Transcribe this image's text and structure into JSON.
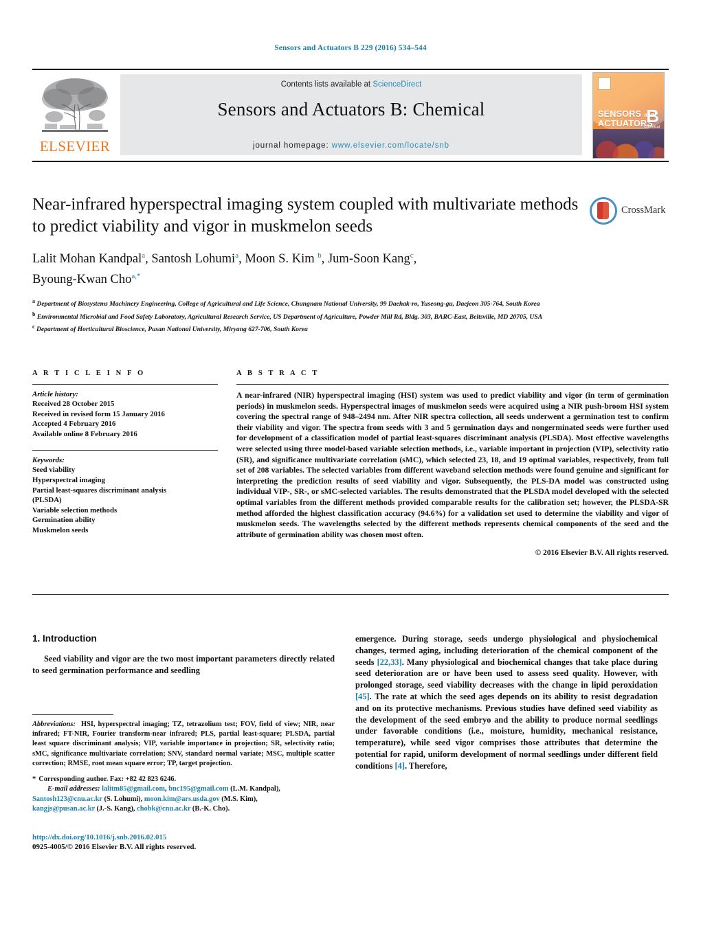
{
  "running_head": "Sensors and Actuators B 229 (2016) 534–544",
  "masthead": {
    "contents_prefix": "Contents lists available at ",
    "sciencedirect": "ScienceDirect",
    "journal_title": "Sensors and Actuators B: Chemical",
    "homepage_label": "journal homepage:",
    "homepage_url": "www.elsevier.com/locate/snb",
    "publisher": "ELSEVIER",
    "cover": {
      "line1": "SENSORS",
      "and": "and",
      "line2": "ACTUATORS",
      "letter": "B",
      "sub": "Chemical"
    },
    "accent_blue": "#2b8cbe",
    "elsevier_orange": "#E87722"
  },
  "article": {
    "title": "Near-infrared hyperspectral imaging system coupled with multivariate methods to predict viability and vigor in muskmelon seeds",
    "authors_line1": "Lalit Mohan Kandpal",
    "authors": [
      {
        "name": "Lalit Mohan Kandpal",
        "sup": "a"
      },
      {
        "name": "Santosh Lohumi",
        "sup": "a"
      },
      {
        "name": "Moon S. Kim",
        "sup": "b"
      },
      {
        "name": "Jum-Soon Kang",
        "sup": "c"
      },
      {
        "name": "Byoung-Kwan Cho",
        "sup": "a,*"
      }
    ],
    "affiliations": [
      {
        "sup": "a",
        "text": "Department of Biosystems Machinery Engineering, College of Agricultural and Life Science, Chungnam National University, 99 Daehak-ro, Yuseong-gu, Daejeon 305-764, South Korea"
      },
      {
        "sup": "b",
        "text": "Environmental Microbial and Food Safety Laboratory, Agricultural Research Service, US Department of Agriculture, Powder Mill Rd, Bldg. 303, BARC-East, Beltsville, MD 20705, USA"
      },
      {
        "sup": "c",
        "text": "Department of Horticultural Bioscience, Pusan National University, Miryang 627-706, South Korea"
      }
    ],
    "crossmark_label": "CrossMark"
  },
  "article_info": {
    "heading": "A R T I C L E   I N F O",
    "history_label": "Article history:",
    "history": [
      "Received 28 October 2015",
      "Received in revised form 15 January 2016",
      "Accepted 4 February 2016",
      "Available online 8 February 2016"
    ],
    "keywords_label": "Keywords:",
    "keywords": [
      "Seed viability",
      "Hyperspectral imaging",
      "Partial least-squares discriminant analysis",
      "(PLSDA)",
      "Variable selection methods",
      "Germination ability",
      "Muskmelon seeds"
    ]
  },
  "abstract": {
    "heading": "A B S T R A C T",
    "text": "A near-infrared (NIR) hyperspectral imaging (HSI) system was used to predict viability and vigor (in term of germination periods) in muskmelon seeds. Hyperspectral images of muskmelon seeds were acquired using a NIR push-broom HSI system covering the spectral range of 948–2494 nm. After NIR spectra collection, all seeds underwent a germination test to confirm their viability and vigor. The spectra from seeds with 3 and 5 germination days and nongerminated seeds were further used for development of a classification model of partial least-squares discriminant analysis (PLSDA). Most effective wavelengths were selected using three model-based variable selection methods, i.e., variable important in projection (VIP), selectivity ratio (SR), and significance multivariate correlation (sMC), which selected 23, 18, and 19 optimal variables, respectively, from full set of 208 variables. The selected variables from different waveband selection methods were found genuine and significant for interpreting the prediction results of seed viability and vigor. Subsequently, the PLS-DA model was constructed using individual VIP-, SR-, or sMC-selected variables. The results demonstrated that the PLSDA model developed with the selected optimal variables from the different methods provided comparable results for the calibration set; however, the PLSDA-SR method afforded the highest classification accuracy (94.6%) for a validation set used to determine the viability and vigor of muskmelon seeds. The wavelengths selected by the different methods represents chemical components of the seed and the attribute of germination ability was chosen most often.",
    "copyright": "© 2016 Elsevier B.V. All rights reserved."
  },
  "body": {
    "section_number_title": "1.  Introduction",
    "left_para": "Seed viability and vigor are the two most important parameters directly related to seed germination performance and seedling",
    "right_para_1": "emergence. During storage, seeds undergo physiological and physiochemical changes, termed aging, including deterioration of the chemical component of the seeds ",
    "right_cite_1": "[22,33]",
    "right_para_2": ". Many physiological and biochemical changes that take place during seed deterioration are or have been used to assess seed quality. However, with prolonged storage, seed viability decreases with the change in lipid peroxidation ",
    "right_cite_2": "[45]",
    "right_para_3": ". The rate at which the seed ages depends on its ability to resist degradation and on its protective mechanisms. Previous studies have defined seed viability as the development of the seed embryo and the ability to produce normal seedlings under favorable conditions (i.e., moisture, humidity, mechanical resistance, temperature), while seed vigor comprises those attributes that determine the potential for rapid, uniform development of normal seedlings under different field conditions ",
    "right_cite_3": "[4]",
    "right_para_4": ". Therefore,"
  },
  "footnotes": {
    "abbrev_label": "Abbreviations:",
    "abbrev_text": "HSI, hyperspectral imaging; TZ, tetrazolium test; FOV, field of view; NIR, near infrared; FT-NIR, Fourier transform-near infrared; PLS, partial least-square; PLSDA, partial least square discriminant analysis; VIP, variable importance in projection; SR, selectivity ratio; sMC, significance multivariate correlation; SNV, standard normal variate; MSC, multiple scatter correction; RMSE, root mean square error; TP, target projection.",
    "corresponding": "Corresponding author. Fax: +82 42 823 6246.",
    "email_label": "E-mail addresses:",
    "emails": [
      {
        "addr": "lalitm85@gmail.com",
        "sep": ", "
      },
      {
        "addr": "bnc195@gmail.com",
        "owner": " (L.M. Kandpal),"
      },
      {
        "addr": "Santosh123@cnu.ac.kr",
        "owner": " (S. Lohumi),"
      },
      {
        "addr": "moon.kim@ars.usda.gov",
        "owner": " (M.S. Kim),"
      },
      {
        "addr": "kangjs@pusan.ac.kr",
        "owner": " (J.-S. Kang),"
      },
      {
        "addr": "chobk@cnu.ac.kr",
        "owner": " (B.-K. Cho)."
      }
    ]
  },
  "doi": {
    "url": "http://dx.doi.org/10.1016/j.snb.2016.02.015",
    "issn_line": "0925-4005/© 2016 Elsevier B.V. All rights reserved."
  }
}
